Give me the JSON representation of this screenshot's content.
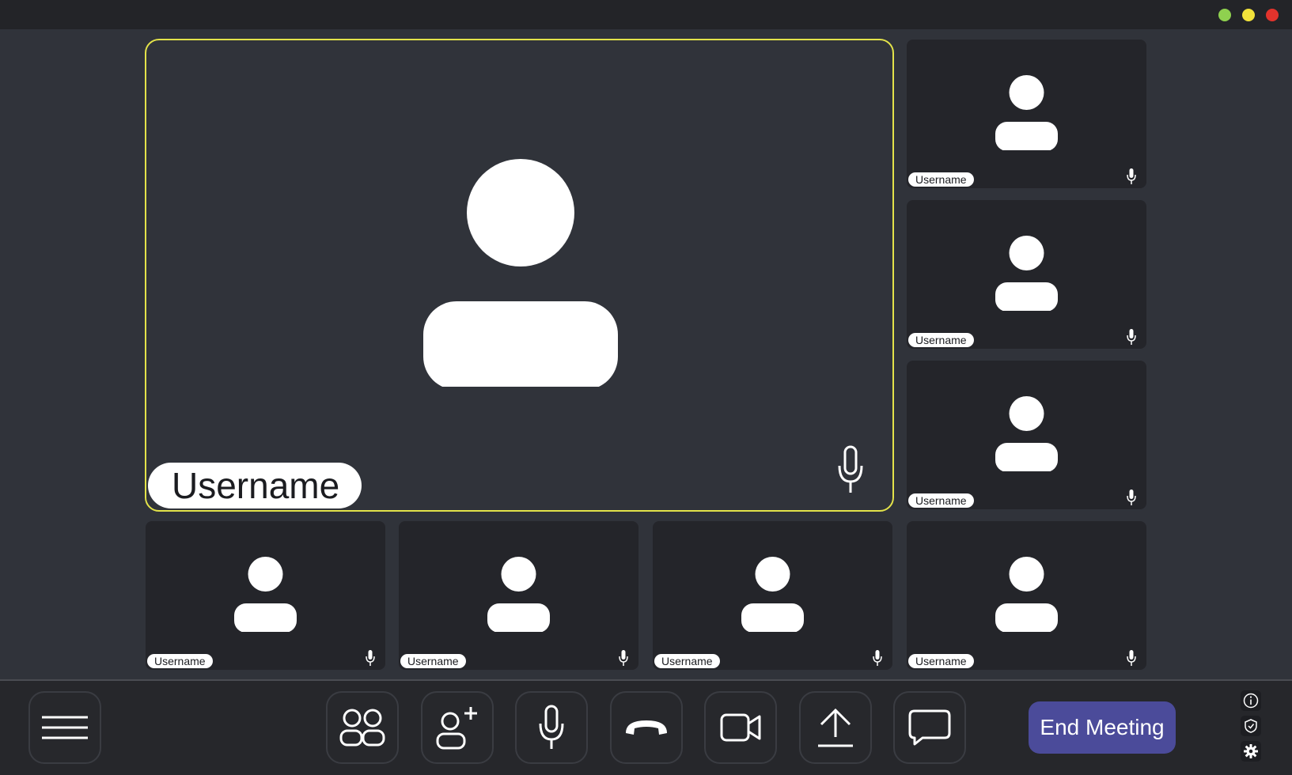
{
  "window": {
    "controls": [
      {
        "name": "green",
        "color": "#8fd14f"
      },
      {
        "name": "yellow",
        "color": "#f2e23b"
      },
      {
        "name": "red",
        "color": "#e2332c"
      }
    ]
  },
  "main_tile": {
    "username": "Username",
    "highlight_color": "#e3e34a"
  },
  "side_tiles": [
    {
      "username": "Username"
    },
    {
      "username": "Username"
    },
    {
      "username": "Username"
    }
  ],
  "bottom_tiles": [
    {
      "username": "Username"
    },
    {
      "username": "Username"
    },
    {
      "username": "Username"
    },
    {
      "username": "Username"
    }
  ],
  "toolbar": {
    "buttons": [
      {
        "icon": "menu-icon"
      },
      {
        "icon": "participants-icon"
      },
      {
        "icon": "add-user-icon"
      },
      {
        "icon": "microphone-icon"
      },
      {
        "icon": "hang-up-icon"
      },
      {
        "icon": "video-camera-icon"
      },
      {
        "icon": "share-screen-icon"
      },
      {
        "icon": "chat-icon"
      }
    ],
    "end_meeting_label": "End Meeting",
    "end_meeting_color": "#4b4b9a"
  },
  "side_icons": [
    "info-icon",
    "shield-icon",
    "gear-icon"
  ]
}
